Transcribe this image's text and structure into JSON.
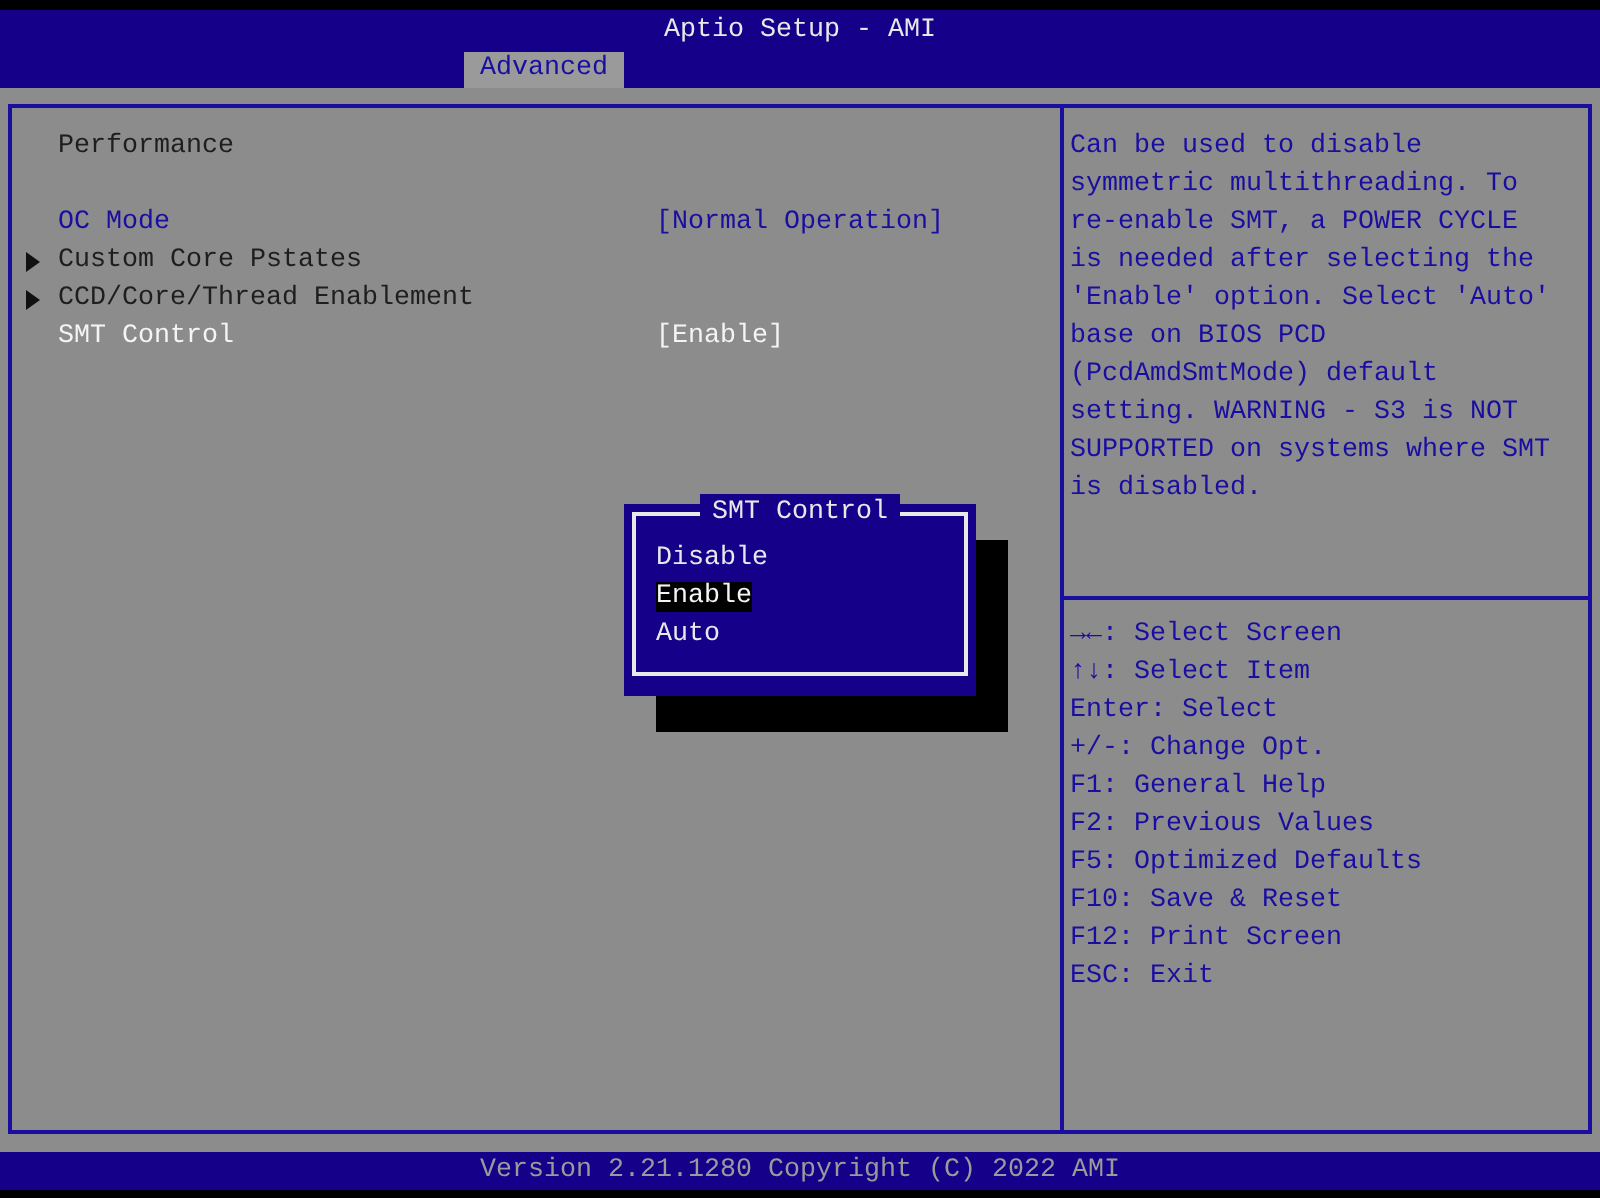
{
  "window": {
    "title": "Aptio Setup - AMI"
  },
  "tabs": [
    {
      "label": "Advanced",
      "selected": true
    }
  ],
  "items": [
    {
      "kind": "title",
      "label": "Performance"
    },
    {
      "kind": "spacer"
    },
    {
      "kind": "option",
      "label": "OC Mode",
      "value": "[Normal Operation]",
      "selected": false
    },
    {
      "kind": "submenu",
      "label": "Custom Core Pstates",
      "selected": false
    },
    {
      "kind": "submenu",
      "label": "CCD/Core/Thread Enablement",
      "selected": false
    },
    {
      "kind": "option",
      "label": "SMT Control",
      "value": "[Enable]",
      "selected": true
    }
  ],
  "help_text": "Can be used to disable symmetric multithreading. To re-enable SMT, a POWER CYCLE is needed after selecting the 'Enable' option. Select 'Auto' base on BIOS PCD (PcdAmdSmtMode) default setting. WARNING - S3 is NOT SUPPORTED on systems where SMT is disabled.",
  "key_help": [
    "→←: Select Screen",
    "↑↓: Select Item",
    "Enter: Select",
    "+/-: Change Opt.",
    "F1: General Help",
    "F2: Previous Values",
    "F5: Optimized Defaults",
    "F10: Save & Reset",
    "F12: Print Screen",
    "ESC: Exit"
  ],
  "popup": {
    "title": "SMT Control",
    "options": [
      {
        "label": "Disable",
        "selected": false
      },
      {
        "label": "Enable",
        "selected": true
      },
      {
        "label": "Auto",
        "selected": false
      }
    ]
  },
  "status_bar": "Version 2.21.1280 Copyright (C) 2022 AMI"
}
